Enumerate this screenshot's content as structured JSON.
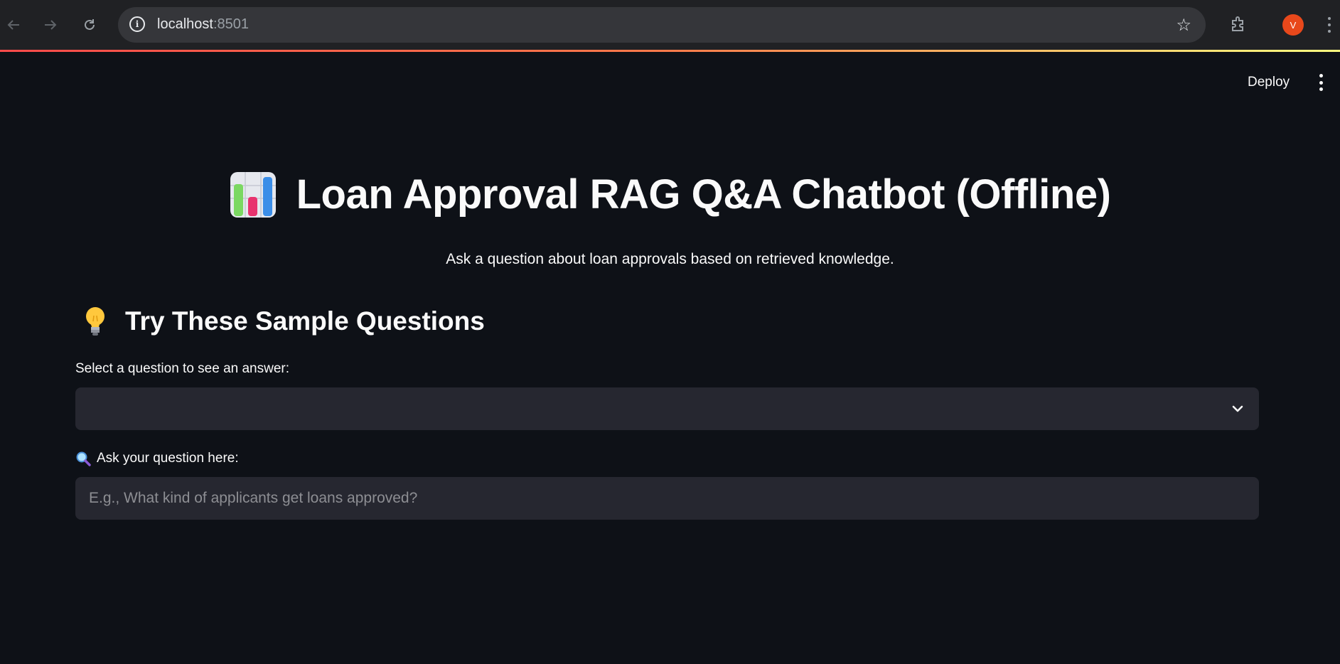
{
  "browser": {
    "url_host": "localhost",
    "url_port": ":8501",
    "avatar_letter": "V",
    "icons": [
      "back-arrow-icon",
      "forward-arrow-icon",
      "reload-icon",
      "site-info-icon",
      "bookmark-star-icon",
      "extensions-icon",
      "browser-menu-icon"
    ]
  },
  "header": {
    "deploy_label": "Deploy",
    "menu_icon": "kebab-menu-icon"
  },
  "main": {
    "title_icon": "bar-chart-emoji",
    "title": "Loan Approval RAG Q&A Chatbot (Offline)",
    "subtitle": "Ask a question about loan approvals based on retrieved knowledge.",
    "section_icon": "light-bulb-emoji",
    "section_title": "Try These Sample Questions",
    "select_label": "Select a question to see an answer:",
    "select_value": "",
    "question_icon": "magnifying-glass-emoji",
    "question_label": "Ask your question here:",
    "question_placeholder": "E.g., What kind of applicants get loans approved?",
    "question_value": ""
  },
  "colors": {
    "background": "#0e1117",
    "input_background": "#262730",
    "accent_gradient_start": "#ff4b4b",
    "accent_gradient_end": "#fffd80",
    "avatar": "#e8481b"
  }
}
